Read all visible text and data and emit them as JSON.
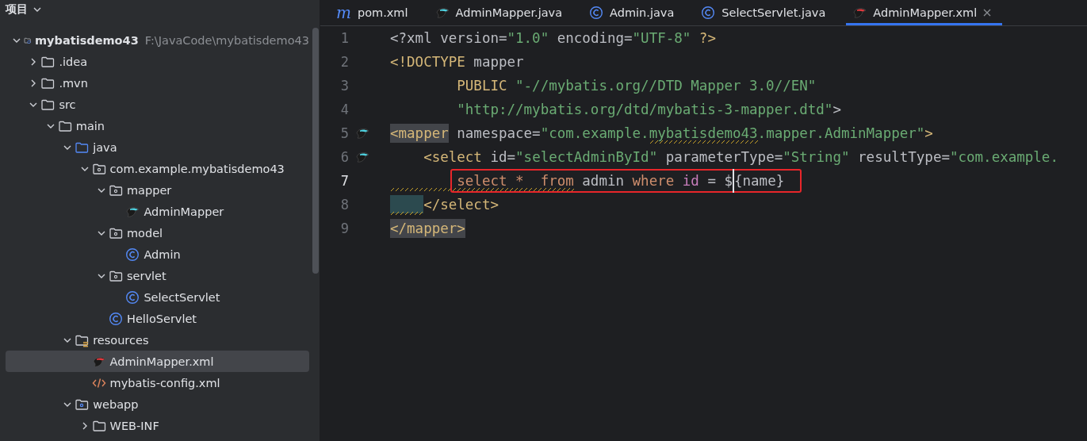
{
  "project_panel": {
    "title": "项目",
    "tree": [
      {
        "label": "mybatisdemo43",
        "path": "F:\\JavaCode\\mybatisdemo43",
        "kind": "module",
        "expanded": true,
        "selected": false,
        "children": [
          {
            "label": ".idea",
            "kind": "folder",
            "expanded": false,
            "selected": false
          },
          {
            "label": ".mvn",
            "kind": "folder",
            "expanded": false,
            "selected": false
          },
          {
            "label": "src",
            "kind": "folder",
            "expanded": true,
            "selected": false,
            "children": [
              {
                "label": "main",
                "kind": "folder",
                "expanded": true,
                "selected": false,
                "children": [
                  {
                    "label": "java",
                    "kind": "source",
                    "expanded": true,
                    "selected": false,
                    "children": [
                      {
                        "label": "com.example.mybatisdemo43",
                        "kind": "package",
                        "expanded": true,
                        "selected": false,
                        "children": [
                          {
                            "label": "mapper",
                            "kind": "package",
                            "expanded": true,
                            "selected": false,
                            "children": [
                              {
                                "label": "AdminMapper",
                                "kind": "mapper",
                                "selected": false
                              }
                            ]
                          },
                          {
                            "label": "model",
                            "kind": "package",
                            "expanded": true,
                            "selected": false,
                            "children": [
                              {
                                "label": "Admin",
                                "kind": "class",
                                "selected": false
                              }
                            ]
                          },
                          {
                            "label": "servlet",
                            "kind": "package",
                            "expanded": true,
                            "selected": false,
                            "children": [
                              {
                                "label": "SelectServlet",
                                "kind": "class",
                                "selected": false
                              }
                            ]
                          },
                          {
                            "label": "HelloServlet",
                            "kind": "class",
                            "selected": false
                          }
                        ]
                      }
                    ]
                  },
                  {
                    "label": "resources",
                    "kind": "resources",
                    "expanded": true,
                    "selected": false,
                    "children": [
                      {
                        "label": "AdminMapper.xml",
                        "kind": "mapper-xml",
                        "selected": true
                      },
                      {
                        "label": "mybatis-config.xml",
                        "kind": "xml",
                        "selected": false
                      }
                    ]
                  },
                  {
                    "label": "webapp",
                    "kind": "web",
                    "expanded": true,
                    "selected": false,
                    "children": [
                      {
                        "label": "WEB-INF",
                        "kind": "folder",
                        "expanded": false,
                        "selected": false
                      }
                    ]
                  }
                ]
              }
            ]
          }
        ]
      }
    ]
  },
  "editor": {
    "tabs": [
      {
        "label": "pom.xml",
        "kind": "maven",
        "icon_text": "m",
        "selected": false
      },
      {
        "label": "AdminMapper.java",
        "kind": "mapper",
        "selected": false
      },
      {
        "label": "Admin.java",
        "kind": "class",
        "selected": false
      },
      {
        "label": "SelectServlet.java",
        "kind": "class",
        "selected": false
      },
      {
        "label": "AdminMapper.xml",
        "kind": "mapper-xml",
        "selected": true
      }
    ],
    "lines": [
      {
        "number": "1",
        "current": false,
        "gutter_mark": false,
        "boxed": false,
        "tokens": [
          {
            "kind": "plain",
            "text": "<?xml version="
          },
          {
            "kind": "value",
            "text": "\"1.0\""
          },
          {
            "kind": "plain",
            "text": " encoding="
          },
          {
            "kind": "value",
            "text": "\"UTF-8\""
          },
          {
            "kind": "tag",
            "text": " ?>"
          }
        ]
      },
      {
        "number": "2",
        "current": false,
        "gutter_mark": false,
        "boxed": false,
        "tokens": [
          {
            "kind": "tag",
            "text": "<!DOCTYPE"
          },
          {
            "kind": "plain",
            "text": " mapper"
          }
        ]
      },
      {
        "number": "3",
        "current": false,
        "gutter_mark": false,
        "boxed": false,
        "kind": "inner",
        "indent_warning": false,
        "indent_highlight": false,
        "tokens": [
          {
            "kind": "tag",
            "text": "PUBLIC "
          },
          {
            "kind": "value",
            "text": "\"-//mybatis.org//DTD Mapper 3.0//EN\""
          }
        ]
      },
      {
        "number": "4",
        "current": false,
        "gutter_mark": false,
        "boxed": false,
        "kind": "inner",
        "indent_warning": false,
        "indent_highlight": false,
        "tokens": [
          {
            "kind": "value",
            "text": "\"http://mybatis.org/dtd/mybatis-3-mapper.dtd\""
          },
          {
            "kind": "plain",
            "text": ">"
          }
        ]
      },
      {
        "number": "5",
        "current": false,
        "gutter_mark": true,
        "boxed": false,
        "tokens": [
          {
            "kind": "tag",
            "text": "<mapper",
            "highlight": true
          },
          {
            "kind": "plain",
            "text": " namespace="
          },
          {
            "kind": "value",
            "text": "\"com.example."
          },
          {
            "kind": "value",
            "text": "mybatisdemo43",
            "warning": true
          },
          {
            "kind": "value",
            "text": ".mapper.AdminMapper\""
          },
          {
            "kind": "tag",
            "text": ">"
          }
        ]
      },
      {
        "number": "6",
        "current": false,
        "gutter_mark": true,
        "boxed": false,
        "kind": "child",
        "indent_warning": false,
        "indent_highlight": false,
        "tokens": [
          {
            "kind": "tag",
            "text": "<select"
          },
          {
            "kind": "plain",
            "text": " id="
          },
          {
            "kind": "value",
            "text": "\"selectAdminById\""
          },
          {
            "kind": "plain",
            "text": " parameterType="
          },
          {
            "kind": "value",
            "text": "\"String\""
          },
          {
            "kind": "plain",
            "text": " resultType="
          },
          {
            "kind": "value",
            "text": "\"com.example."
          }
        ]
      },
      {
        "number": "7",
        "current": true,
        "gutter_mark": false,
        "boxed": true,
        "kind": "inner",
        "indent_warning": true,
        "indent_highlight": false,
        "tokens": [
          {
            "kind": "keyword",
            "text": "select *  from",
            "warning": true
          },
          {
            "kind": "plain",
            "text": " admin "
          },
          {
            "kind": "keyword",
            "text": "where"
          },
          {
            "kind": "column",
            "text": " id"
          },
          {
            "kind": "plain",
            "text": " = $"
          },
          {
            "kind": "plain",
            "text": "{name}",
            "cursor": true
          }
        ]
      },
      {
        "number": "8",
        "current": false,
        "gutter_mark": false,
        "boxed": false,
        "kind": "child",
        "indent_warning": true,
        "indent_highlight": true,
        "tokens": [
          {
            "kind": "tag",
            "text": "</select>"
          }
        ]
      },
      {
        "number": "9",
        "current": false,
        "gutter_mark": false,
        "boxed": false,
        "tokens": [
          {
            "kind": "tag",
            "text": "</mapper>",
            "highlight": true
          }
        ]
      }
    ]
  }
}
